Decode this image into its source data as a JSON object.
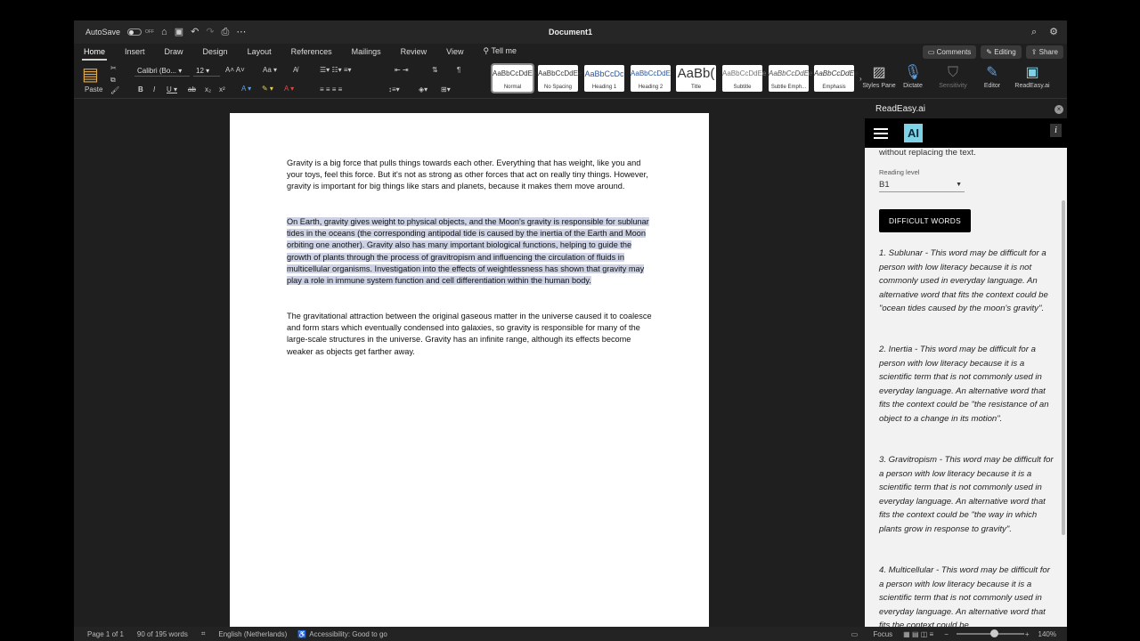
{
  "window": {
    "autosave_label": "AutoSave",
    "autosave_state": "OFF",
    "doc_title": "Document1"
  },
  "tabs": [
    "Home",
    "Insert",
    "Draw",
    "Design",
    "Layout",
    "References",
    "Mailings",
    "Review",
    "View",
    "Tell me"
  ],
  "actions": {
    "comments": "Comments",
    "editing": "Editing",
    "share": "Share"
  },
  "ribbon": {
    "paste": "Paste",
    "font_name": "Calibri (Bo...",
    "font_size": "12",
    "styles": [
      {
        "sample": "AaBbCcDdEe",
        "label": "Normal"
      },
      {
        "sample": "AaBbCcDdEe",
        "label": "No Spacing"
      },
      {
        "sample": "AaBbCcDc",
        "label": "Heading 1"
      },
      {
        "sample": "AaBbCcDdE",
        "label": "Heading 2"
      },
      {
        "sample": "AaBb(",
        "label": "Title"
      },
      {
        "sample": "AaBbCcDdEe",
        "label": "Subtitle"
      },
      {
        "sample": "AaBbCcDdEe",
        "label": "Subtle Emph..."
      },
      {
        "sample": "AaBbCcDdEe",
        "label": "Emphasis"
      }
    ],
    "styles_pane": "Styles Pane",
    "dictate": "Dictate",
    "sensitivity": "Sensitivity",
    "editor": "Editor",
    "readeasy": "ReadEasy.ai"
  },
  "document": {
    "paragraphs": [
      "Gravity is a big force that pulls things towards each other. Everything that has weight, like you and your toys, feel this force. But it's not as strong as other forces that act on really tiny things. However, gravity is important for big things like stars and planets, because it makes them move around.",
      "On Earth, gravity gives weight to physical objects, and the Moon's gravity is responsible for sublunar tides in the oceans (the corresponding antipodal tide is caused by the inertia of the Earth and Moon orbiting one another). Gravity also has many important biological functions, helping to guide the growth of plants through the process of gravitropism and influencing the circulation of fluids in multicellular organisms. Investigation into the effects of weightlessness has shown that gravity may play a role in immune system function and cell differentiation within the human body.",
      "The gravitational attraction between the original gaseous matter in the universe caused it to coalesce and form stars which eventually condensed into galaxies, so gravity is responsible for many of the large-scale structures in the universe. Gravity has an infinite range, although its effects become weaker as objects get farther away."
    ]
  },
  "pane": {
    "title": "ReadEasy.ai",
    "logo": "AI",
    "info": "i",
    "intro_tail": "without replacing the text.",
    "reading_level_label": "Reading level",
    "reading_level_value": "B1",
    "difficult_words_button": "DIFFICULT WORDS",
    "words": [
      "1. Sublunar - This word may be difficult for a person with low literacy because it is not commonly used in everyday language. An alternative word that fits the context could be \"ocean tides caused by the moon's gravity\".",
      "2. Inertia - This word may be difficult for a person with low literacy because it is a scientific term that is not commonly used in everyday language. An alternative word that fits the context could be \"the resistance of an object to a change in its motion\".",
      "3. Gravitropism - This word may be difficult for a person with low literacy because it is a scientific term that is not commonly used in everyday language. An alternative word that fits the context could be \"the way in which plants grow in response to gravity\".",
      "4. Multicellular - This word may be difficult for a person with low literacy because it is a scientific term that is not commonly used in everyday language. An alternative word that fits the context could be..."
    ]
  },
  "status": {
    "page": "Page 1 of 1",
    "words": "90 of 195 words",
    "language": "English (Netherlands)",
    "accessibility": "Accessibility: Good to go",
    "focus": "Focus",
    "zoom": "140%"
  }
}
